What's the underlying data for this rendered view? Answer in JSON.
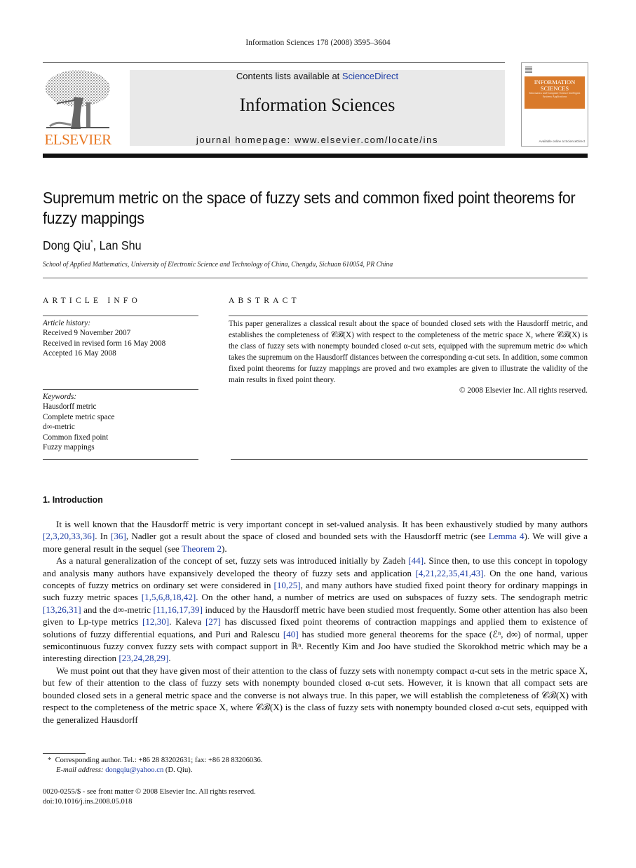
{
  "running_head": "Information Sciences 178 (2008) 3595–3604",
  "header": {
    "publisher_logo_text": "ELSEVIER",
    "contents_prefix": "Contents lists available at ",
    "contents_link": "ScienceDirect",
    "journal_title": "Information Sciences",
    "homepage": "journal homepage: www.elsevier.com/locate/ins",
    "cover": {
      "title_line1": "INFORMATION",
      "title_line2": "SCIENCES",
      "subtitle": "Informatics and Computer Science Intelligent Systems Applications",
      "foot": "Available online at ScienceDirect"
    },
    "colors": {
      "elsevier_orange": "#e87722",
      "link_blue": "#1f3ea6",
      "cover_orange": "#d97a2b",
      "banner_gray": "#e9e9e9"
    }
  },
  "article": {
    "title": "Supremum metric on the space of fuzzy sets and common fixed point theorems for fuzzy mappings",
    "authors": [
      {
        "name": "Dong Qiu",
        "mark": "*"
      },
      {
        "name": "Lan Shu",
        "mark": ""
      }
    ],
    "author_separator": ", ",
    "affiliation": "School of Applied Mathematics, University of Electronic Science and Technology of China, Chengdu, Sichuan 610054, PR China"
  },
  "article_info": {
    "heading": "ARTICLE INFO",
    "history_label": "Article history:",
    "history": [
      "Received 9 November 2007",
      "Received in revised form 16 May 2008",
      "Accepted 16 May 2008"
    ],
    "keywords_label": "Keywords:",
    "keywords": [
      "Hausdorff metric",
      "Complete metric space",
      "d∞-metric",
      "Common fixed point",
      "Fuzzy mappings"
    ]
  },
  "abstract": {
    "heading": "ABSTRACT",
    "text": "This paper generalizes a classical result about the space of bounded closed sets with the Hausdorff metric, and establishes the completeness of 𝒞ℬ(X) with respect to the completeness of the metric space X, where 𝒞ℬ(X) is the class of fuzzy sets with nonempty bounded closed α-cut sets, equipped with the supremum metric d∞ which takes the supremum on the Hausdorff distances between the corresponding α-cut sets. In addition, some common fixed point theorems for fuzzy mappings are proved and two examples are given to illustrate the validity of the main results in fixed point theory.",
    "copyright": "© 2008 Elsevier Inc. All rights reserved."
  },
  "section1": {
    "heading": "1. Introduction",
    "paragraphs": [
      [
        {
          "t": "It is well known that the Hausdorff metric is very important concept in set-valued analysis. It has been exhaustively studied by many authors "
        },
        {
          "t": "[2,3,20,33,36]",
          "link": true
        },
        {
          "t": ". In "
        },
        {
          "t": "[36]",
          "link": true
        },
        {
          "t": ", Nadler got a result about the space of closed and bounded sets with the Hausdorff metric (see "
        },
        {
          "t": "Lemma 4",
          "link": true
        },
        {
          "t": "). We will give a more general result in the sequel (see "
        },
        {
          "t": "Theorem 2",
          "link": true
        },
        {
          "t": ")."
        }
      ],
      [
        {
          "t": "As a natural generalization of the concept of set, fuzzy sets was introduced initially by Zadeh "
        },
        {
          "t": "[44]",
          "link": true
        },
        {
          "t": ". Since then, to use this concept in topology and analysis many authors have expansively developed the theory of fuzzy sets and application "
        },
        {
          "t": "[4,21,22,35,41,43]",
          "link": true
        },
        {
          "t": ". On the one hand, various concepts of fuzzy metrics on ordinary set were considered in "
        },
        {
          "t": "[10,25]",
          "link": true
        },
        {
          "t": ", and many authors have studied fixed point theory for ordinary mappings in such fuzzy metric spaces "
        },
        {
          "t": "[1,5,6,8,18,42]",
          "link": true
        },
        {
          "t": ". On the other hand, a number of metrics are used on subspaces of fuzzy sets. The sendograph metric "
        },
        {
          "t": "[13,26,31]",
          "link": true
        },
        {
          "t": " and the d∞-metric "
        },
        {
          "t": "[11,16,17,39]",
          "link": true
        },
        {
          "t": " induced by the Hausdorff metric have been studied most frequently. Some other attention has also been given to Lp-type metrics "
        },
        {
          "t": "[12,30]",
          "link": true
        },
        {
          "t": ". Kaleva "
        },
        {
          "t": "[27]",
          "link": true
        },
        {
          "t": " has discussed fixed point theorems of contraction mappings and applied them to existence of solutions of fuzzy differential equations, and Puri and Ralescu "
        },
        {
          "t": "[40]",
          "link": true
        },
        {
          "t": " has studied more general theorems for the space (ℰⁿ, d∞) of normal, upper semicontinuous fuzzy convex fuzzy sets with compact support in ℝⁿ. Recently Kim and Joo have studied the Skorokhod metric which may be a interesting direction "
        },
        {
          "t": "[23,24,28,29]",
          "link": true
        },
        {
          "t": "."
        }
      ],
      [
        {
          "t": "We must point out that they have given most of their attention to the class of fuzzy sets with nonempty compact α-cut sets in the metric space X, but few of their attention to the class of fuzzy sets with nonempty bounded closed α-cut sets. However, it is known that all compact sets are bounded closed sets in a general metric space and the converse is not always true. In this paper, we will establish the completeness of 𝒞ℬ(X) with respect to the completeness of the metric space X, where 𝒞ℬ(X) is the class of fuzzy sets with nonempty bounded closed α-cut sets, equipped with the generalized Hausdorff"
        }
      ]
    ]
  },
  "footnotes": {
    "mark": "*",
    "corresponding": "Corresponding author. Tel.: +86 28 83202631; fax: +86 28 83206036.",
    "email_label": "E-mail address: ",
    "email": "dongqiu@yahoo.cn",
    "email_suffix": " (D. Qiu)."
  },
  "front_matter": {
    "issn_line": "0020-0255/$ - see front matter © 2008 Elsevier Inc. All rights reserved.",
    "doi": "doi:10.1016/j.ins.2008.05.018"
  }
}
